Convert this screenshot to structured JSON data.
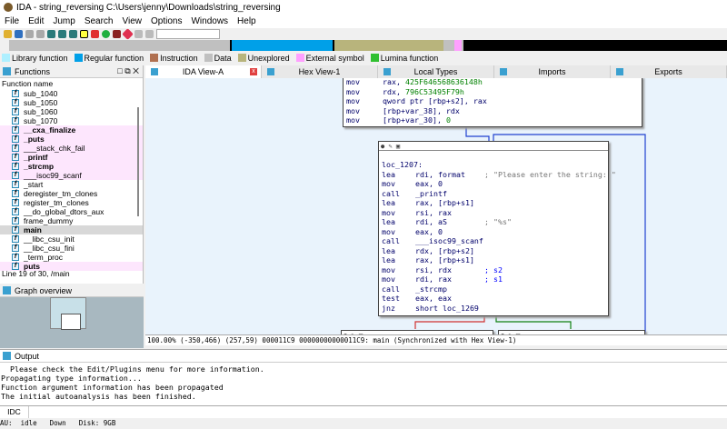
{
  "window": {
    "title": "IDA - string_reversing C:\\Users\\jenny\\Downloads\\string_reversing"
  },
  "menu": [
    "File",
    "Edit",
    "Jump",
    "Search",
    "View",
    "Options",
    "Windows",
    "Help"
  ],
  "legend": [
    {
      "label": "Library function",
      "color": "#aef0ff"
    },
    {
      "label": "Regular function",
      "color": "#00a0e8"
    },
    {
      "label": "Instruction",
      "color": "#b07050"
    },
    {
      "label": "Data",
      "color": "#c0c0c0"
    },
    {
      "label": "Unexplored",
      "color": "#b8b47c"
    },
    {
      "label": "External symbol",
      "color": "#ffa0ff"
    },
    {
      "label": "Lumina function",
      "color": "#30c030"
    }
  ],
  "functions": {
    "title": "Functions",
    "column": "Function name",
    "status": "Line 19 of 30, /main",
    "items": [
      {
        "name": "sub_1040",
        "style": ""
      },
      {
        "name": "sub_1050",
        "style": ""
      },
      {
        "name": "sub_1060",
        "style": ""
      },
      {
        "name": "sub_1070",
        "style": ""
      },
      {
        "name": "__cxa_finalize",
        "style": "lib"
      },
      {
        "name": "_puts",
        "style": "lib"
      },
      {
        "name": "___stack_chk_fail",
        "style": "libn"
      },
      {
        "name": "_printf",
        "style": "lib"
      },
      {
        "name": "_strcmp",
        "style": "lib"
      },
      {
        "name": "___isoc99_scanf",
        "style": "libn"
      },
      {
        "name": "_start",
        "style": ""
      },
      {
        "name": "deregister_tm_clones",
        "style": ""
      },
      {
        "name": "register_tm_clones",
        "style": ""
      },
      {
        "name": "__do_global_dtors_aux",
        "style": ""
      },
      {
        "name": "frame_dummy",
        "style": ""
      },
      {
        "name": "main",
        "style": "sel"
      },
      {
        "name": "__libc_csu_init",
        "style": ""
      },
      {
        "name": "__libc_csu_fini",
        "style": ""
      },
      {
        "name": "_term_proc",
        "style": ""
      },
      {
        "name": "puts",
        "style": "lib"
      }
    ]
  },
  "graph_overview": {
    "title": "Graph overview"
  },
  "tabs": [
    "IDA View-A",
    "Hex View-1",
    "Local Types",
    "Imports",
    "Exports"
  ],
  "top_node": [
    [
      "mov",
      "rax, ",
      "425F646568636148h",
      ""
    ],
    [
      "mov",
      "rdx, ",
      "796C53495F79h",
      ""
    ],
    [
      "mov",
      "qword ptr [rbp+s2], rax",
      "",
      ""
    ],
    [
      "mov",
      "[rbp+var_38], rdx",
      "",
      ""
    ],
    [
      "mov",
      "[rbp+var_30], ",
      "0",
      ""
    ]
  ],
  "main_node": {
    "label": "loc_1207:",
    "rows": [
      [
        "lea",
        "rdi, format",
        "; \"Please enter the string: \""
      ],
      [
        "mov",
        "eax, 0",
        ""
      ],
      [
        "call",
        "_printf",
        ""
      ],
      [
        "lea",
        "rax, [rbp+s1]",
        ""
      ],
      [
        "mov",
        "rsi, rax",
        ""
      ],
      [
        "lea",
        "rdi, aS",
        "; \"%s\""
      ],
      [
        "mov",
        "eax, 0",
        ""
      ],
      [
        "call",
        "___isoc99_scanf",
        ""
      ],
      [
        "lea",
        "rdx, [rbp+s2]",
        ""
      ],
      [
        "lea",
        "rax, [rbp+s1]",
        ""
      ],
      [
        "mov",
        "rsi, rdx",
        "; s2"
      ],
      [
        "mov",
        "rdi, rax",
        "; s1"
      ],
      [
        "call",
        "_strcmp",
        ""
      ],
      [
        "test",
        "eax, eax",
        ""
      ],
      [
        "jnz",
        "short loc_1269",
        ""
      ]
    ]
  },
  "graph_status": "100.00% (-350,466) (257,59) 000011C9 00000000000011C9: main (Synchronized with Hex View-1)",
  "output": {
    "title": "Output",
    "lines": [
      "  Please check the Edit/Plugins menu for more information.",
      "Propagating type information...",
      "Function argument information has been propagated",
      "The initial autoanalysis has been finished."
    ]
  },
  "idc": "IDC",
  "statusbar": [
    "AU:  idle",
    "Down",
    "Disk: 9GB"
  ]
}
